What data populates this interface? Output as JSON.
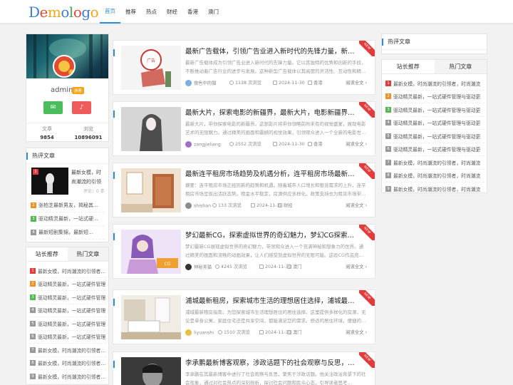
{
  "site": {
    "logo": "Demologo",
    "nav": [
      "首页",
      "推荐",
      "热点",
      "财经",
      "香港",
      "澳门"
    ],
    "active_nav": 0
  },
  "profile": {
    "name": "admin",
    "badge": "游客",
    "stats": [
      {
        "label": "文章",
        "value": "9854"
      },
      {
        "label": "浏览",
        "value": "10896091"
      }
    ]
  },
  "left_hot": {
    "title": "热评文章",
    "featured": {
      "num": "1",
      "title": "最新女模，时尚潮流的引领者…",
      "comments": "评论：0 条"
    },
    "items": [
      {
        "num": "2",
        "title": "张柏芝最新男友，揭秘其…"
      },
      {
        "num": "3",
        "title": "驱动精灵最新，一站式硬…"
      },
      {
        "num": "4",
        "title": "最新短剧集锦，最新短…"
      }
    ]
  },
  "left_rank": {
    "tabs": [
      "站长推荐",
      "热门文章"
    ],
    "items": [
      {
        "num": "1",
        "title": "最新女模，时尚潮流的引领者…"
      },
      {
        "num": "2",
        "title": "驱动精灵最新，一站式硬件管理…"
      },
      {
        "num": "3",
        "title": "驱动精灵最新，一站式硬件管理…"
      },
      {
        "num": "4",
        "title": "驱动精灵最新，一站式硬件管理…"
      },
      {
        "num": "5",
        "title": "驱动精灵最新，一站式硬件管理…"
      },
      {
        "num": "6",
        "title": "驱动精灵最新，一站式硬件管理…"
      },
      {
        "num": "7",
        "title": "最新女模，时尚潮流的引领者…"
      },
      {
        "num": "8",
        "title": "最新女模，时尚潮流的引领者…"
      },
      {
        "num": "9",
        "title": "最新女模，时尚潮流的引领者…"
      }
    ]
  },
  "right": {
    "hot_title": "热评文章",
    "tabs": [
      "站长推荐",
      "热门文章"
    ],
    "items": [
      {
        "num": "1",
        "title": "最新女模，时尚潮流的引领者，时尚潮流"
      },
      {
        "num": "2",
        "title": "驱动精灵最新，一站式硬件管理与驱动更"
      },
      {
        "num": "3",
        "title": "驱动精灵最新，一站式硬件管理与驱动更"
      },
      {
        "num": "4",
        "title": "驱动精灵最新，一站式硬件管理与驱动更"
      },
      {
        "num": "5",
        "title": "驱动精灵最新，一站式硬件管理与驱动更"
      },
      {
        "num": "6",
        "title": "驱动精灵最新，一站式硬件管理与驱动更"
      },
      {
        "num": "7",
        "title": "最新女模，时尚潮流的引领者，时尚潮流"
      },
      {
        "num": "8",
        "title": "最新女模，时尚潮流的引领者，时尚潮流"
      },
      {
        "num": "9",
        "title": "最新女模，时尚潮流的引领者，时尚潮流"
      }
    ]
  },
  "articles": [
    {
      "title": "最新广告载体，引领广告业进入新时代的先锋力量，新时代先…",
      "excerpt": "最新广告载体成为引领广告业进入新时代的先锋力量。它以其独特的优势和创新的手段，不断推动着广告行业的进步与发展。这种新型广告载体以其高度的灵活性、互动性和精…",
      "author": "夜色中的猫",
      "views": "1138 次浏览",
      "date": "2024-11-30",
      "category": "香港",
      "readmore": "阅读全文",
      "ribbon": "NEW",
      "avatar_color": "#7ab0e0"
    },
    {
      "title": "最新大片，探索电影的新疆界，最新大片，电影新疆界的探索…",
      "excerpt": "最新大片，带你探索电影的新疆界。这部影片将带你领略前所未有的视觉盛宴，展现电影艺术的无限魅力。通过精美的画面和震撼的视觉效果，引领观众进入一个全新的电影世…",
      "author": "zangjieliang",
      "views": "2552 次浏览",
      "date": "2024-11-30",
      "category": "香港",
      "readmore": "阅读全文",
      "ribbon": "NEW",
      "avatar_color": "#a06ec8"
    },
    {
      "title": "最新连平租房市场趋势及机遇分析，连平租房市场最新趋势与…",
      "excerpt": "摘要：连平租房市场正经历新的趋势和机遇。随着城市人口增长和租赁需求的上升，连平租房市场呈现出活跃态势。租金水平稳定，房源供应多样化，政策支持也为租赁市场带…",
      "author": "shishan",
      "views": "133 次浏览",
      "date": "2024-11-30",
      "category": "财经",
      "readmore": "阅读全文",
      "ribbon": "NEW",
      "avatar_color": "#8c8c8c"
    },
    {
      "title": "梦幻最新CG，探索虚拟世界的奇幻魅力，梦幻CG探索虚拟世…",
      "excerpt": "梦幻最新CG展现虚拟世界的奇幻魅力，带领观众进入一个充满神秘和想象力的世界。通过精美的画面和流畅的动画效果，让人们感受到虚拟世界的无限可能。这段CG作品充…",
      "author": "神秘黑猫",
      "views": "4245 次浏览",
      "date": "2024-11-30",
      "category": "澳门",
      "readmore": "阅读全文",
      "ribbon": "NEW",
      "avatar_color": "#333333"
    },
    {
      "title": "浦城最新租房，探索城市生活的理想居住选择，浦城最新租房…",
      "excerpt": "浦城最新租房指南，为您探索城市生活理想居住的居住选择。这里提供多样化的房源，无论是单身公寓、家庭住宅还是共享空间，都能满足您的需求。舒适的居住环境，便捷的…",
      "author": "liyuanshi",
      "views": "1510 次浏览",
      "date": "2024-11-30",
      "category": "澳门",
      "readmore": "阅读全文",
      "ribbon": "NEW",
      "avatar_color": "#e8c040"
    },
    {
      "title": "李承鹏最新博客观察，涉政话题下的社会观察与反思，李承鹏…",
      "excerpt": "李承鹏在其最新博客中进行了社会观察与反思，聚焦于涉政话题。他关注政治背景下的社会现象，通过对社会热点的深刻剖析，探讨社会问题和民众心态，引导读者思考…",
      "author": "",
      "views": "",
      "date": "",
      "category": "",
      "readmore": "",
      "ribbon": "NEW",
      "avatar_color": "#aaaaaa"
    }
  ],
  "colors": {
    "accent": "#2d8cd8",
    "ribbon": "#e23b3b",
    "green": "#4cbd5c",
    "red": "#ef5b5b",
    "badge": "#f7a21b"
  }
}
